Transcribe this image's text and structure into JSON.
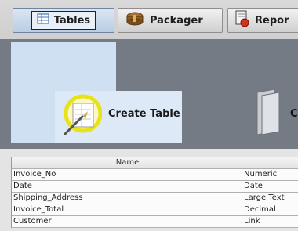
{
  "tabs": [
    {
      "label": "Tables",
      "icon": "table-icon",
      "active": true
    },
    {
      "label": "Packager",
      "icon": "packager-icon",
      "active": false
    },
    {
      "label": "Repor",
      "icon": "report-icon",
      "active": false
    }
  ],
  "panel": {
    "create_table_label": "Create Table",
    "next_label_fragment": "C"
  },
  "table": {
    "headers": [
      "Name",
      ""
    ],
    "rows": [
      [
        "Invoice_No",
        "Numeric"
      ],
      [
        "Date",
        "Date"
      ],
      [
        "Shipping_Address",
        "Large Text"
      ],
      [
        "Invoice_Total",
        "Decimal"
      ],
      [
        "Customer",
        "Link"
      ]
    ]
  },
  "colors": {
    "active_tab": "#c9daee",
    "panel_bg": "#757b84",
    "highlight_circle": "#e8e21a"
  }
}
